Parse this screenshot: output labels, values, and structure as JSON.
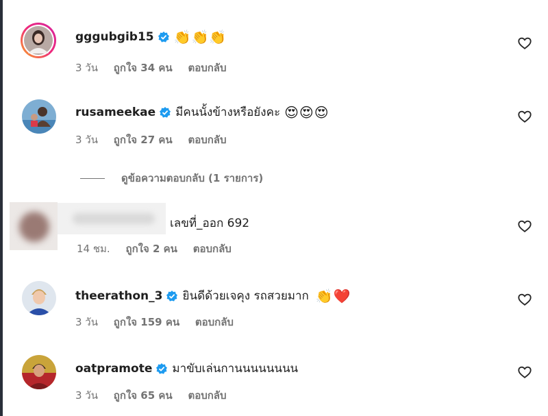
{
  "comments": [
    {
      "username": "gggubgib15",
      "verified": true,
      "text": "",
      "emoji": "👏👏👏",
      "time": "3 วัน",
      "likes": "ถูกใจ 34 คน",
      "reply": "ตอบกลับ"
    },
    {
      "username": "rusameekae",
      "verified": true,
      "text": "มีคนนั้งข้างหรือยังคะ",
      "emoji": "😍😍😍",
      "time": "3 วัน",
      "likes": "ถูกใจ 27 คน",
      "reply": "ตอบกลับ"
    },
    {
      "username": "",
      "verified": false,
      "text": "เลขที่_ออก 692",
      "emoji": "",
      "time": "14 ชม.",
      "likes": "ถูกใจ 2 คน",
      "reply": "ตอบกลับ"
    },
    {
      "username": "theerathon_3",
      "verified": true,
      "text": "ยินดีด้วยเจคุง รถสวยมาก",
      "emoji": "👏❤️",
      "time": "3 วัน",
      "likes": "ถูกใจ 159 คน",
      "reply": "ตอบกลับ"
    },
    {
      "username": "oatpramote",
      "verified": true,
      "text": "มาขับเล่นกานนนนนนนน",
      "emoji": "",
      "time": "3 วัน",
      "likes": "ถูกใจ 65 คน",
      "reply": "ตอบกลับ"
    }
  ],
  "view_replies": "ดูข้อความตอบกลับ (1 รายการ)",
  "colors": {
    "verified": "#1d9bf0",
    "story_ring_start": "#f9a825",
    "story_ring_end": "#d6249f",
    "meta_text": "#737373"
  }
}
